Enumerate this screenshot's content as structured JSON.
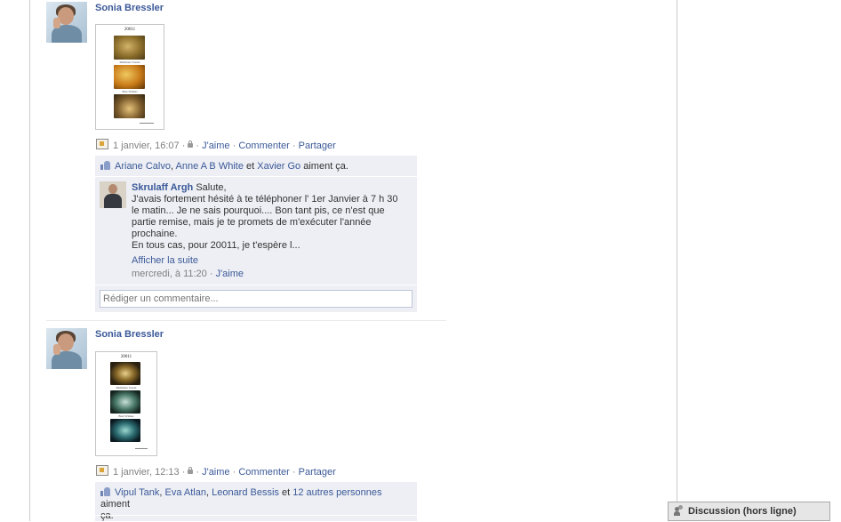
{
  "posts": [
    {
      "author": "Sonia Bressler",
      "photo": {
        "title": "20011",
        "label1": "Meilleurs Voeux",
        "label2": "Best Wishes"
      },
      "meta": {
        "time": "1 janvier, 16:07",
        "sep": "·",
        "like": "J'aime",
        "comment": "Commenter",
        "share": "Partager"
      },
      "likes": {
        "people": [
          "Ariane Calvo",
          "Anne A B White"
        ],
        "and": "et",
        "last": "Xavier Go",
        "suffix": "aiment ça."
      },
      "comment": {
        "author": "Skrulaff Argh",
        "text_lines": [
          "Salute,",
          "J'avais fortement hésité à te téléphoner l' 1er Janvier à 7 h 30",
          "le matin... Je ne sais pourquoi.... Bon tant pis, ce n'est que",
          "partie remise, mais je te promets de m'exécuter l'année",
          "prochaine.",
          "En tous cas, pour 20011, je t'espère l..."
        ],
        "see_more": "Afficher la suite",
        "time": "mercredi, à 11:20",
        "like": "J'aime"
      },
      "comment_input_placeholder": "Rédiger un commentaire..."
    },
    {
      "author": "Sonia Bressler",
      "photo": {
        "title": "20011",
        "label1": "Meilleurs Voeux",
        "label2": "Best Wishes"
      },
      "meta": {
        "time": "1 janvier, 12:13",
        "sep": "·",
        "like": "J'aime",
        "comment": "Commenter",
        "share": "Partager"
      },
      "likes": {
        "people": [
          "Vipul Tank",
          "Eva Atlan",
          "Leonard Bessis"
        ],
        "and": "et",
        "others": "12 autres personnes",
        "suffix_1": "aiment",
        "suffix_2": "ça."
      }
    }
  ],
  "chat": {
    "label": "Discussion (hors ligne)"
  },
  "colors": {
    "link": "#3b5998",
    "ufi_bg": "#edeff4",
    "meta_gray": "#808080"
  }
}
